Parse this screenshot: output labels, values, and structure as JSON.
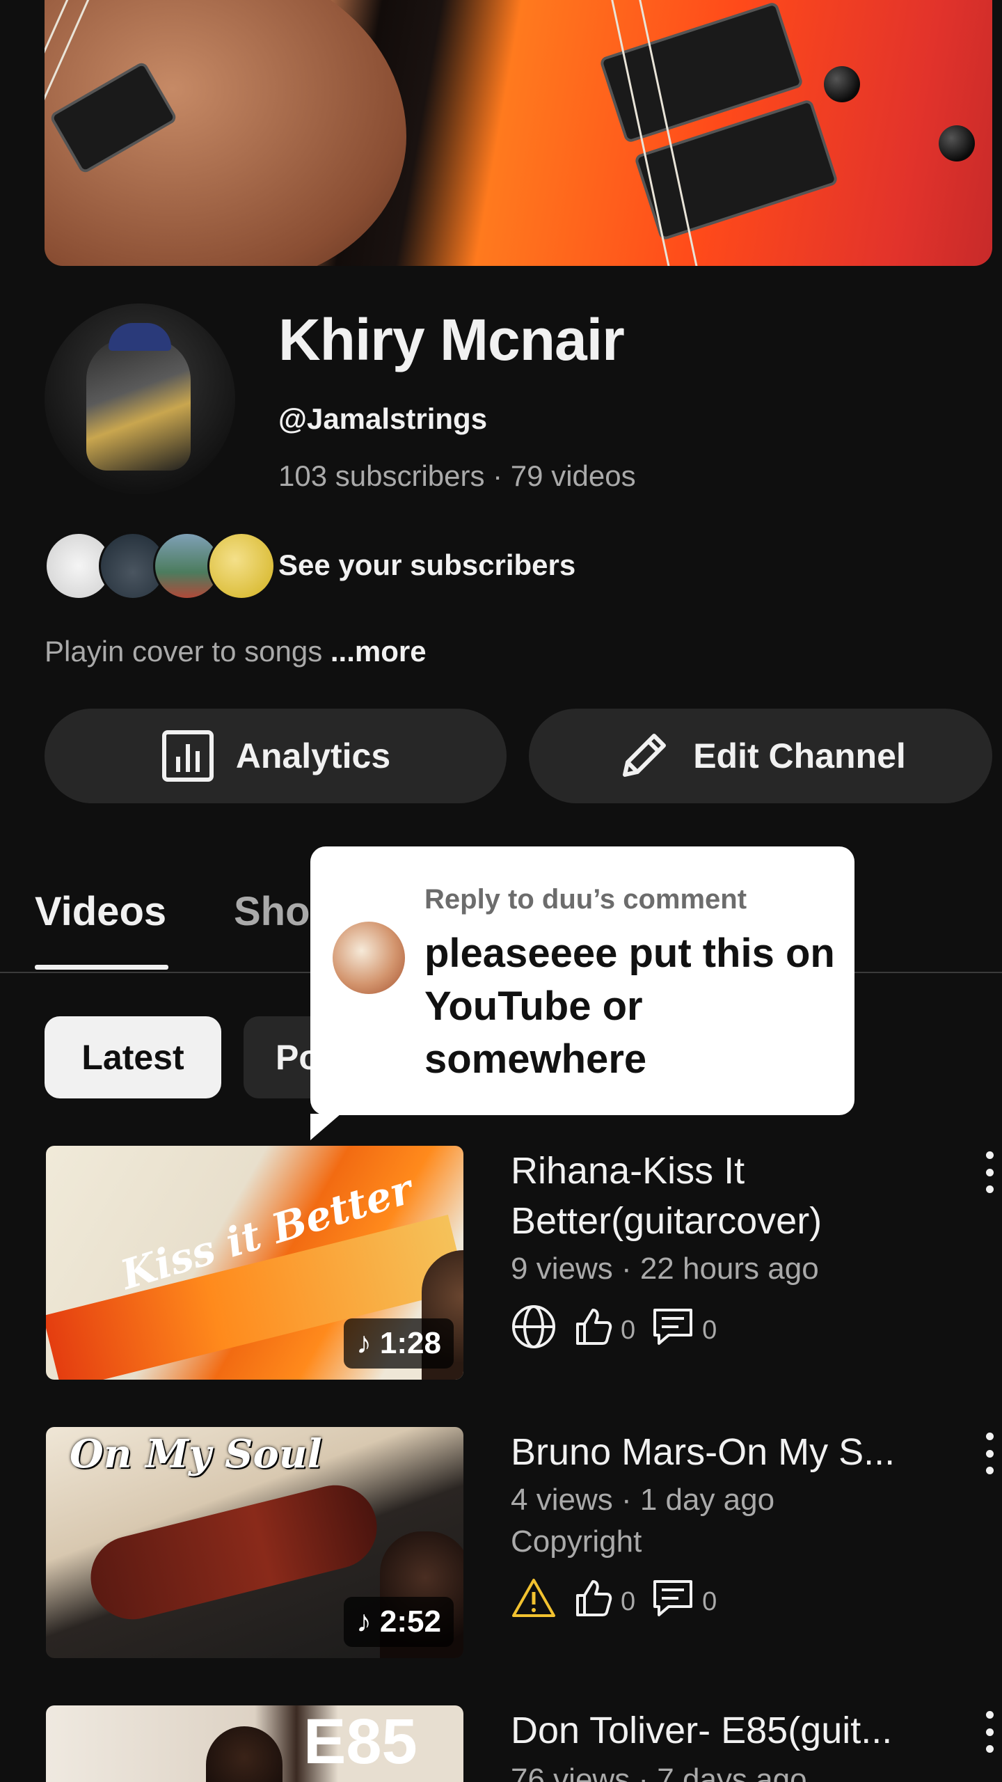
{
  "channel": {
    "name": "Khiry Mcnair",
    "handle": "@Jamalstrings",
    "stats": "103 subscribers · 79 videos",
    "see_subscribers": "See your subscribers",
    "description": "Playin cover to songs ",
    "more_label": "...more"
  },
  "buttons": {
    "analytics": "Analytics",
    "edit_channel": "Edit Channel"
  },
  "tabs": [
    {
      "label": "Videos",
      "active": true
    },
    {
      "label": "Sho",
      "active": false
    }
  ],
  "chips": [
    {
      "label": "Latest",
      "active": true
    },
    {
      "label": "Po",
      "active": false
    }
  ],
  "reply_popup": {
    "title": "Reply to duu’s comment",
    "text": "pleaseeee put this on YouTube or somewhere"
  },
  "videos": [
    {
      "title": "Rihana-Kiss It Better(guitarcover)",
      "meta": "9 views · 22 hours ago",
      "duration": "1:28",
      "thumb_text": "Kiss it Better",
      "status_icon": "globe-icon",
      "likes": "0",
      "comments": "0"
    },
    {
      "title": "Bruno Mars-On My S...",
      "meta": "4 views · 1 day ago",
      "extra": "Copyright",
      "duration": "2:52",
      "thumb_text": "On My Soul",
      "status_icon": "warning-icon",
      "status_color": "#f2c230",
      "likes": "0",
      "comments": "0"
    },
    {
      "title": "Don Toliver- E85(guit...",
      "meta": "76 views · 7 days ago",
      "thumb_text": "E85"
    }
  ]
}
